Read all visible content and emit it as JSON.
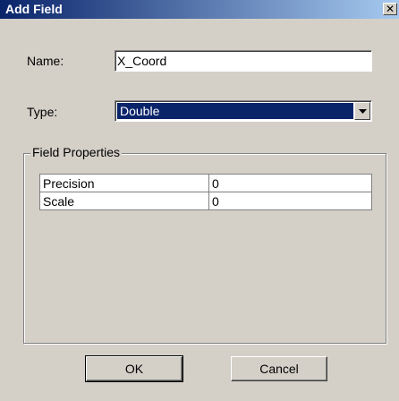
{
  "window": {
    "title": "Add Field",
    "close_glyph": "✕"
  },
  "form": {
    "name_label": "Name:",
    "name_value": "X_Coord",
    "type_label": "Type:",
    "type_value": "Double"
  },
  "field_properties": {
    "label": "Field Properties",
    "rows": [
      {
        "name": "Precision",
        "value": "0"
      },
      {
        "name": "Scale",
        "value": "0"
      }
    ]
  },
  "buttons": {
    "ok_label": "OK",
    "cancel_label": "Cancel"
  },
  "colors": {
    "titlebar_start": "#0a246a",
    "titlebar_end": "#a6caf0",
    "dialog_bg": "#d4d0c8",
    "selection": "#0a246a"
  }
}
